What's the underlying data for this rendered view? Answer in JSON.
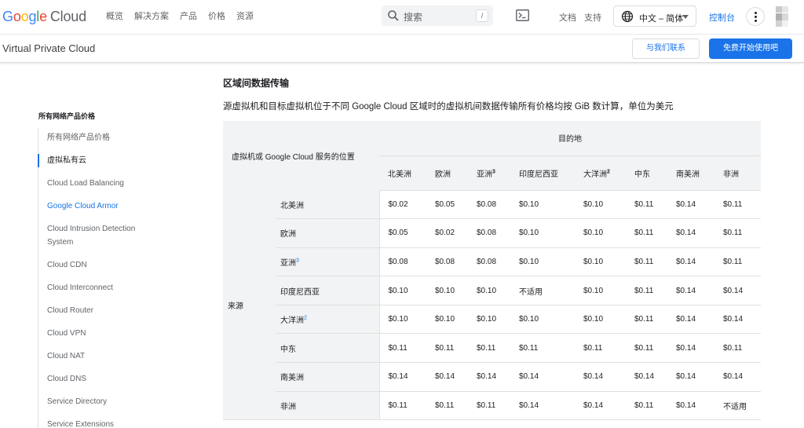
{
  "topnav": {
    "logo_text": "Google",
    "logo_product": "Cloud",
    "links": [
      "概览",
      "解决方案",
      "产品",
      "价格",
      "资源"
    ],
    "search_placeholder": "搜索",
    "search_shortcut": "/",
    "docs_label": "文档",
    "support_label": "支持",
    "language_label": "中文 – 简体",
    "console_label": "控制台"
  },
  "subheader": {
    "product_name": "Virtual Private Cloud",
    "contact_label": "与我们联系",
    "trial_label": "免费开始使用吧"
  },
  "sidebar": {
    "heading": "所有网络产品价格",
    "items": [
      {
        "label": "所有网络产品价格",
        "state": "normal"
      },
      {
        "label": "虚拟私有云",
        "state": "active"
      },
      {
        "label": "Cloud Load Balancing",
        "state": "normal"
      },
      {
        "label": "Google Cloud Armor",
        "state": "link"
      },
      {
        "label": "Cloud Intrusion Detection System",
        "state": "normal"
      },
      {
        "label": "Cloud CDN",
        "state": "normal"
      },
      {
        "label": "Cloud Interconnect",
        "state": "normal"
      },
      {
        "label": "Cloud Router",
        "state": "normal"
      },
      {
        "label": "Cloud VPN",
        "state": "normal"
      },
      {
        "label": "Cloud NAT",
        "state": "normal"
      },
      {
        "label": "Cloud DNS",
        "state": "normal"
      },
      {
        "label": "Service Directory",
        "state": "normal"
      },
      {
        "label": "Service Extensions",
        "state": "normal"
      }
    ]
  },
  "content": {
    "title": "区域间数据传输",
    "description": "源虚拟机和目标虚拟机位于不同 Google Cloud 区域时的虚拟机间数据传输所有价格均按 GiB 数计算，单位为美元"
  },
  "table": {
    "corner_label": "虚拟机或 Google Cloud 服务的位置",
    "destination_label": "目的地",
    "source_label": "来源",
    "columns": [
      {
        "label": "北美洲",
        "sup": ""
      },
      {
        "label": "欧洲",
        "sup": ""
      },
      {
        "label": "亚洲",
        "sup": "3"
      },
      {
        "label": "印度尼西亚",
        "sup": ""
      },
      {
        "label": "大洋洲",
        "sup": "2"
      },
      {
        "label": "中东",
        "sup": ""
      },
      {
        "label": "南美洲",
        "sup": ""
      },
      {
        "label": "非洲",
        "sup": ""
      }
    ],
    "rows": [
      {
        "region": "北美洲",
        "sup": "",
        "prices": [
          "$0.02",
          "$0.05",
          "$0.08",
          "$0.10",
          "$0.10",
          "$0.11",
          "$0.14",
          "$0.11"
        ]
      },
      {
        "region": "欧洲",
        "sup": "",
        "prices": [
          "$0.05",
          "$0.02",
          "$0.08",
          "$0.10",
          "$0.10",
          "$0.11",
          "$0.14",
          "$0.11"
        ]
      },
      {
        "region": "亚洲",
        "sup": "3",
        "prices": [
          "$0.08",
          "$0.08",
          "$0.08",
          "$0.10",
          "$0.10",
          "$0.11",
          "$0.14",
          "$0.11"
        ]
      },
      {
        "region": "印度尼西亚",
        "sup": "",
        "prices": [
          "$0.10",
          "$0.10",
          "$0.10",
          "不适用",
          "$0.10",
          "$0.11",
          "$0.14",
          "$0.14"
        ]
      },
      {
        "region": "大洋洲",
        "sup": "2",
        "prices": [
          "$0.10",
          "$0.10",
          "$0.10",
          "$0.10",
          "$0.10",
          "$0.11",
          "$0.14",
          "$0.14"
        ]
      },
      {
        "region": "中东",
        "sup": "",
        "prices": [
          "$0.11",
          "$0.11",
          "$0.11",
          "$0.11",
          "$0.11",
          "$0.11",
          "$0.14",
          "$0.11"
        ]
      },
      {
        "region": "南美洲",
        "sup": "",
        "prices": [
          "$0.14",
          "$0.14",
          "$0.14",
          "$0.14",
          "$0.14",
          "$0.14",
          "$0.14",
          "$0.14"
        ]
      },
      {
        "region": "非洲",
        "sup": "",
        "prices": [
          "$0.11",
          "$0.11",
          "$0.11",
          "$0.14",
          "$0.14",
          "$0.11",
          "$0.14",
          "不适用"
        ]
      }
    ]
  },
  "colors": {
    "accent": "#1a73e8",
    "table_header_bg": "#f1f3f4",
    "text": "#202124",
    "muted": "#5f6368"
  }
}
